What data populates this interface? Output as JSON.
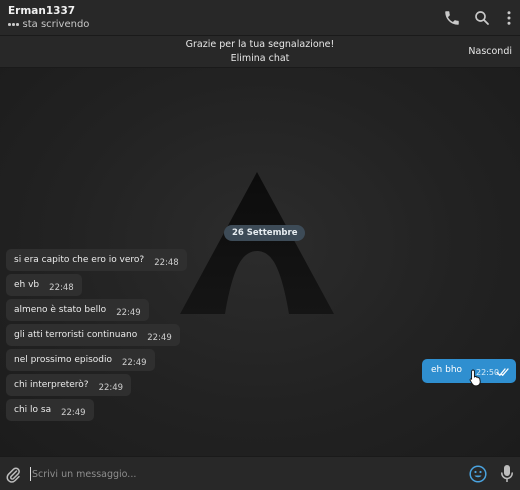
{
  "header": {
    "contact_name": "Erman1337",
    "status": "sta scrivendo",
    "icons": [
      "phone-icon",
      "search-icon",
      "more-vertical-icon"
    ]
  },
  "report_bar": {
    "title": "Grazie per la tua segnalazione!",
    "delete_label": "Elimina chat",
    "hide_label": "Nascondi"
  },
  "chat": {
    "date_badge": "26 Settembre",
    "incoming": [
      {
        "text": "si era capito che ero io vero?",
        "time": "22:48"
      },
      {
        "text": "eh vb",
        "time": "22:48"
      },
      {
        "text": "almeno è stato bello",
        "time": "22:49"
      },
      {
        "text": "gli atti terroristi continuano",
        "time": "22:49"
      },
      {
        "text": "nel prossimo episodio",
        "time": "22:49"
      },
      {
        "text": "chi interpreterò?",
        "time": "22:49"
      },
      {
        "text": "chi lo sa",
        "time": "22:49"
      }
    ],
    "outgoing": {
      "text": "eh bho",
      "time": "22:50",
      "status": "read"
    }
  },
  "composer": {
    "placeholder": "Scrivi un messaggio...",
    "icons": [
      "paperclip-icon",
      "emoji-icon",
      "microphone-icon"
    ]
  },
  "colors": {
    "background": "#1e1e1e",
    "panel": "#282828",
    "incoming_bubble": "#2f2f2f",
    "outgoing_bubble": "#2f8fd0",
    "accent": "#4aa3df"
  }
}
